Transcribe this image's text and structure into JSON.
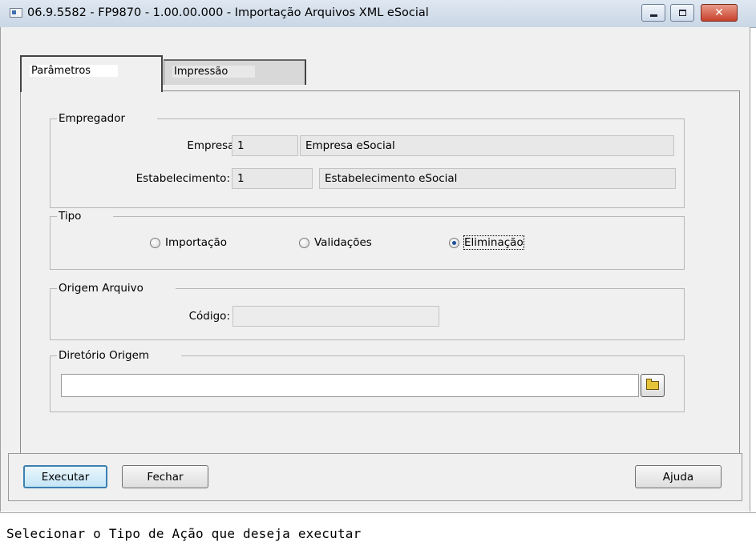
{
  "window": {
    "title": "06.9.5582 - FP9870 - 1.00.00.000 - Importação Arquivos XML eSocial",
    "controls": {
      "minimize_icon": "minimize-icon",
      "maximize_icon": "maximize-icon",
      "close_icon": "close-icon"
    }
  },
  "tabs": [
    {
      "label": "Parâmetros",
      "active": true
    },
    {
      "label": "Impressão",
      "active": false
    }
  ],
  "empregador": {
    "legend": "Empregador",
    "empresa": {
      "label": "Empresa:",
      "code": "1",
      "name": "Empresa eSocial"
    },
    "estabelecimento": {
      "label": "Estabelecimento:",
      "code": "1",
      "name": "Estabelecimento eSocial"
    }
  },
  "tipo": {
    "legend": "Tipo",
    "options": [
      {
        "label": "Importação",
        "checked": false
      },
      {
        "label": "Validações",
        "checked": false
      },
      {
        "label": "Eliminação",
        "checked": true
      }
    ]
  },
  "origem_arquivo": {
    "legend": "Origem Arquivo",
    "codigo": {
      "label": "Código:",
      "value": ""
    }
  },
  "diretorio_origem": {
    "legend": "Diretório Origem",
    "value": "",
    "browse_icon": "folder-open-icon"
  },
  "buttons": {
    "executar": "Executar",
    "fechar": "Fechar",
    "ajuda": "Ajuda"
  },
  "status": {
    "text": "Selecionar o Tipo de Ação que deseja executar"
  }
}
